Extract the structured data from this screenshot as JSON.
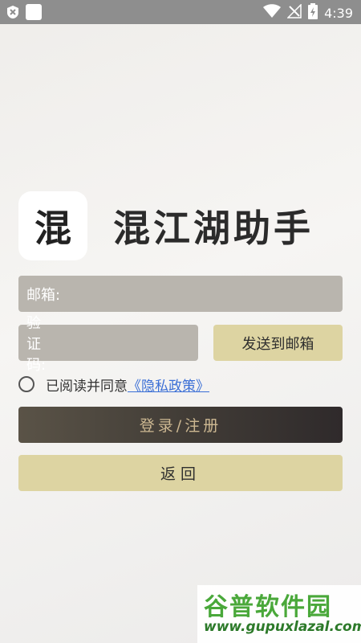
{
  "status_bar": {
    "time": "4:39",
    "icons": [
      "close-badge-icon",
      "white-square-icon",
      "wifi-icon",
      "no-signal-icon",
      "battery-charging-icon"
    ]
  },
  "app": {
    "logo_char": "混",
    "title": "混江湖助手"
  },
  "form": {
    "email_label": "邮箱:",
    "email_value": "",
    "code_label": "验证码:",
    "code_value": "",
    "send_button": "发送到邮箱",
    "agree_text": "已阅读并同意",
    "policy_link": "《隐私政策》",
    "login_button": "登录/注册",
    "back_button": "返回"
  },
  "watermark": {
    "title": "谷普软件园",
    "url": "www.gupuxlazal.com"
  },
  "colors": {
    "accent_gold": "#ddd4a2",
    "field_gray": "#b9b5ae",
    "login_dark": "#3f3a35",
    "link_blue": "#3b6fd6"
  }
}
